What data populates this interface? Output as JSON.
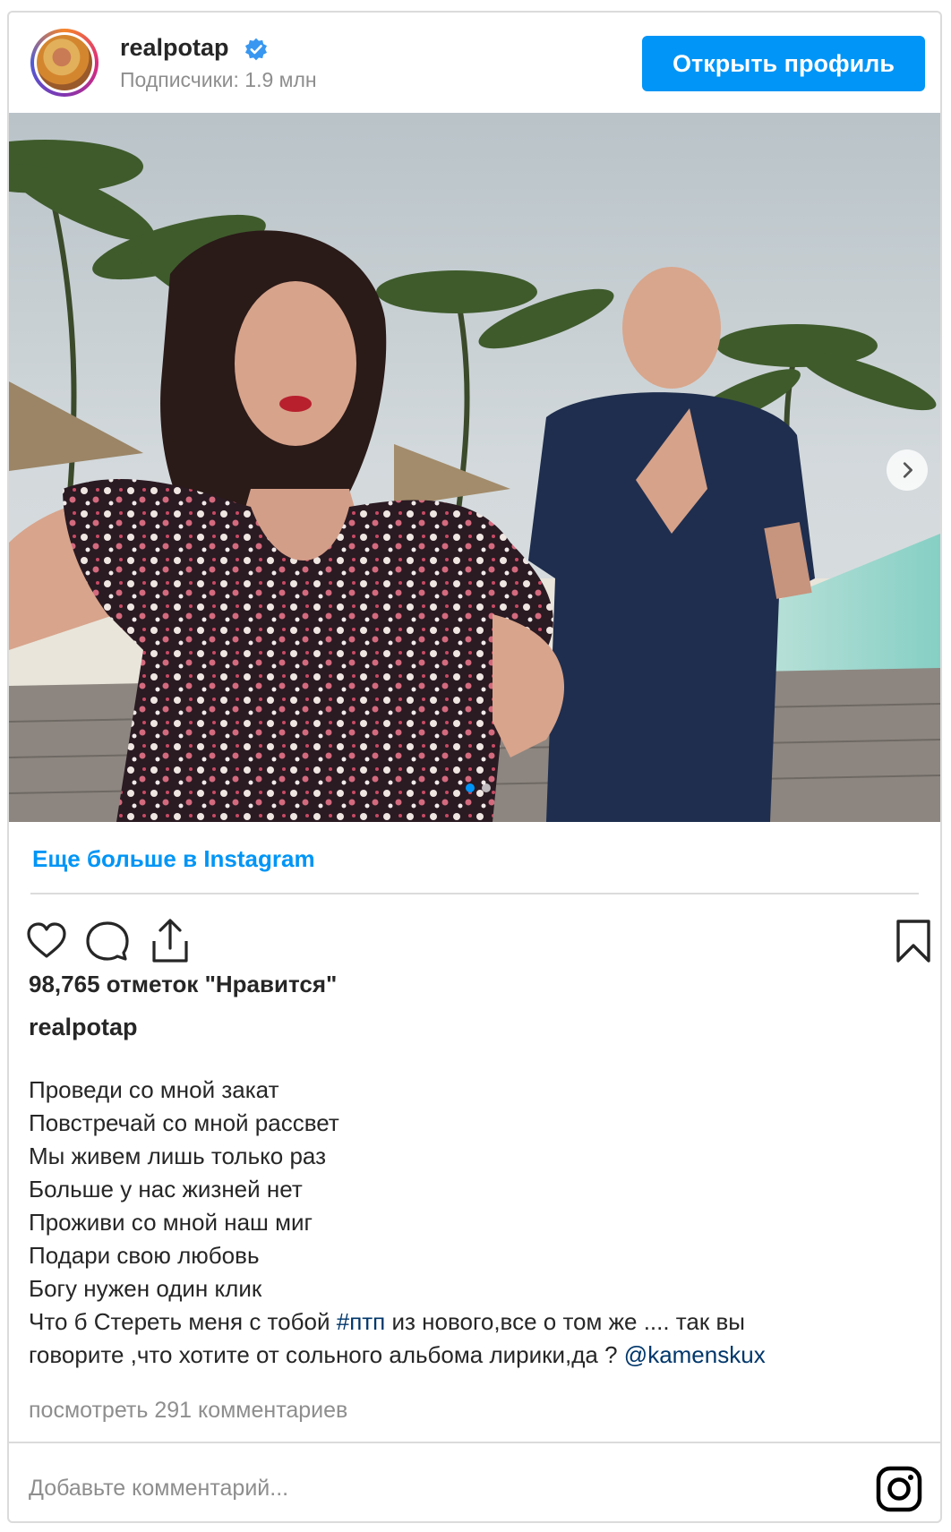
{
  "header": {
    "username": "realpotap",
    "followers": "Подписчики: 1.9 млн",
    "open_profile_button": "Открыть профиль"
  },
  "post": {
    "more_link": "Еще больше в Instagram",
    "likes": "98,765 отметок \"Нравится\"",
    "author": "realpotap",
    "caption_lines": [
      "Проведи со мной закат",
      "Повстречай со мной рассвет",
      "Мы живем лишь только раз",
      "Больше у нас жизней нет",
      "Проживи со мной наш миг",
      "Подари свою любовь",
      "Богу нужен один клик"
    ],
    "caption_tail": {
      "text_a": "Что б Стереть меня с тобой ",
      "hashtag": "#птп",
      "text_b": " из нового,все о том же .... так вы",
      "text_c": "говорите ,что хотите от сольного альбома лирики,да ? ",
      "mention": "@kamenskux"
    },
    "view_comments": "посмотреть 291 комментариев",
    "comment_placeholder": "Добавьте комментарий...",
    "carousel_active_index": 0,
    "carousel_count": 2
  },
  "icons": {
    "like": "heart-icon",
    "comment": "comment-icon",
    "share": "share-icon",
    "save": "bookmark-icon",
    "verified": "verified-badge-icon",
    "instagram": "instagram-icon",
    "next": "chevron-right-icon"
  },
  "colors": {
    "accent": "#0095f6",
    "link": "#00376b",
    "muted": "#8e8e8e",
    "text": "#262626"
  }
}
